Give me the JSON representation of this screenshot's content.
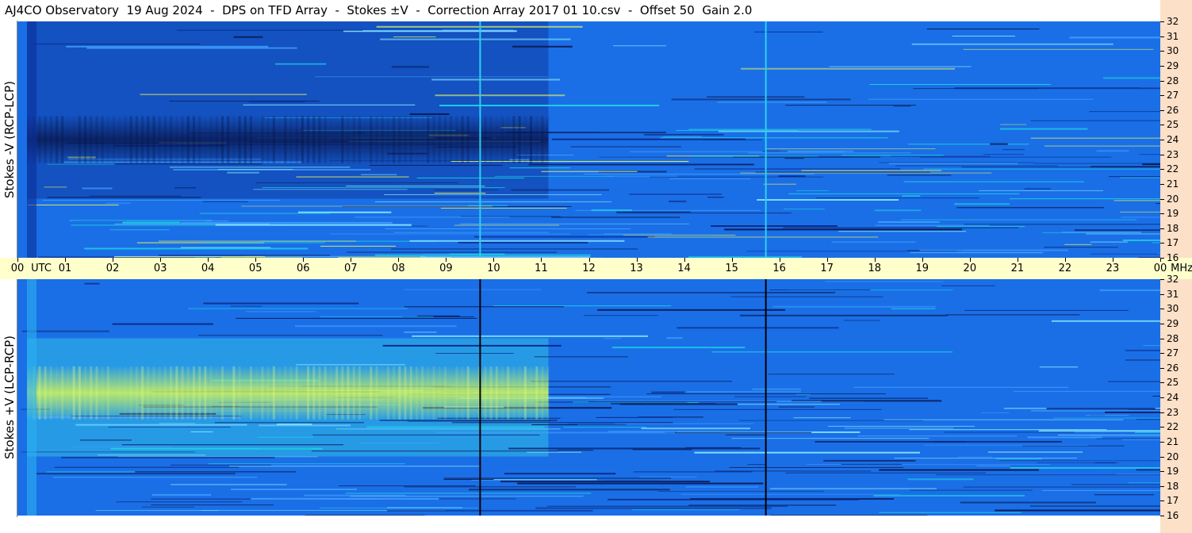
{
  "title": "AJ4CO Observatory  19 Aug 2024  -  DPS on TFD Array  -  Stokes ±V  -  Correction Array 2017 01 10.csv  -  Offset 50  Gain 2.0",
  "panels": {
    "top": {
      "ylabel": "Stokes -V (RCP-LCP)"
    },
    "bottom": {
      "ylabel": "Stokes +V (LCP-RCP)"
    }
  },
  "colors": {
    "background": "#ffffff",
    "time_axis_bg": "#ffffcc",
    "freq_axis_bg": "#fde0c8",
    "spectrogram_base": "#1a6fe6",
    "v_minus_dark": "#0a1a55",
    "v_plus_bright": "#c8f060"
  },
  "chart_data": {
    "type": "heatmap",
    "x_unit": "UTC",
    "y_unit": "MHz",
    "xlim": [
      0,
      24
    ],
    "ylim": [
      16,
      32
    ],
    "x_ticks": [
      "00",
      "UTC",
      "01",
      "02",
      "03",
      "04",
      "05",
      "06",
      "07",
      "08",
      "09",
      "10",
      "11",
      "12",
      "13",
      "14",
      "15",
      "16",
      "17",
      "18",
      "19",
      "20",
      "21",
      "22",
      "23",
      "00",
      "MHz"
    ],
    "y_ticks": [
      "32",
      "31",
      "30",
      "29",
      "28",
      "27",
      "26",
      "25",
      "24",
      "23",
      "22",
      "21",
      "20",
      "19",
      "18",
      "17",
      "16"
    ],
    "series": [
      {
        "name": "Stokes -V (RCP-LCP)",
        "event": {
          "t_start": 0.2,
          "t_end": 11.15,
          "f_center": 24,
          "f_width": 1.6,
          "sign": "dark"
        }
      },
      {
        "name": "Stokes +V (LCP-RCP)",
        "event": {
          "t_start": 0.2,
          "t_end": 11.15,
          "f_center": 24.3,
          "f_width": 1.8,
          "sign": "bright"
        }
      }
    ],
    "vertical_lines_utc": [
      9.7,
      15.7
    ],
    "grid": false
  }
}
